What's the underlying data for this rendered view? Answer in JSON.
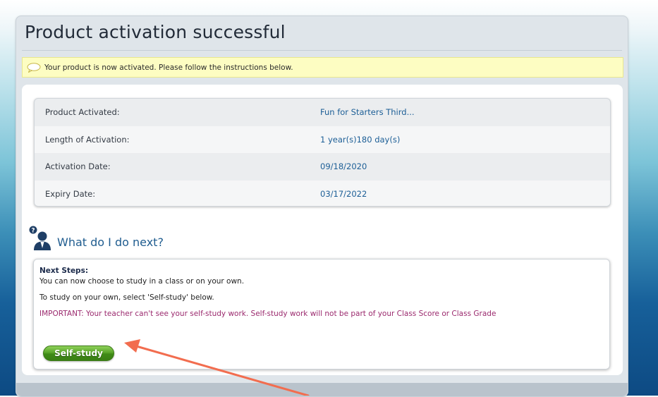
{
  "page": {
    "title": "Product activation successful"
  },
  "notice": {
    "text": "Your product is now activated. Please follow the instructions below."
  },
  "activation": {
    "rows": [
      {
        "label": "Product Activated:",
        "value": "Fun for Starters Third..."
      },
      {
        "label": "Length of Activation:",
        "value": "1 year(s)180 day(s)"
      },
      {
        "label": "Activation Date:",
        "value": "09/18/2020"
      },
      {
        "label": "Expiry Date:",
        "value": "03/17/2022"
      }
    ]
  },
  "next": {
    "title": "What do I do next?",
    "heading": "Next Steps:",
    "line1": "You can now choose to study in a class or on your own.",
    "line2": "To study on your own, select 'Self-study' below.",
    "important": "IMPORTANT: Your teacher can't see your self-study work. Self-study work will not be part of your Class Score or Class Grade",
    "button_label": "Self-study"
  },
  "colors": {
    "accent": "#1f5c8f",
    "notice_bg": "#fdfdc2",
    "important_text": "#9b2a6e",
    "button_green": "#4a9a1f",
    "annotation_arrow": "#f26d4f"
  },
  "icons": {
    "notice": "speech-bubble-icon",
    "next": "help-person-icon",
    "annotation": "pointer-arrow-icon"
  }
}
